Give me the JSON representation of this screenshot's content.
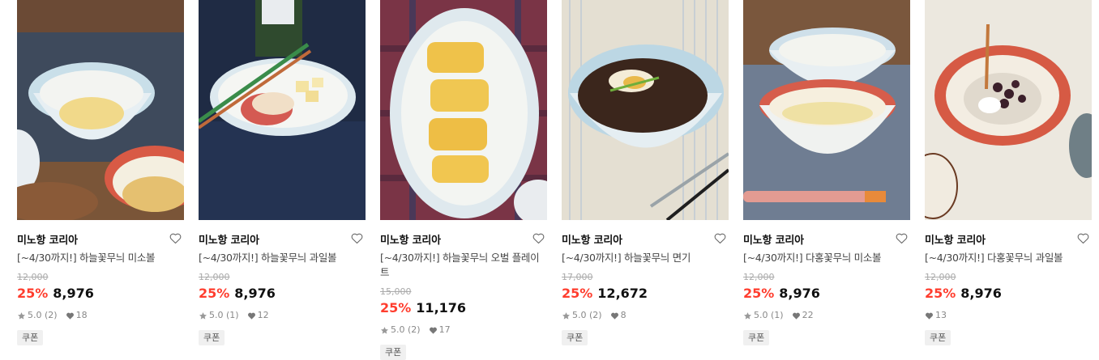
{
  "colors": {
    "accent_discount": "#ff3d2e",
    "text_strong": "#111111",
    "text_muted": "#888888"
  },
  "products": [
    {
      "brand": "미노항 코리아",
      "title": "[~4/30까지!] 하늘꽃무늬 미소볼",
      "original_price": "12,000",
      "discount": "25%",
      "price": "8,976",
      "rating": "5.0 (2)",
      "likes": "18",
      "coupon": "쿠폰",
      "image": "bowl-of-egg-salad"
    },
    {
      "brand": "미노항 코리아",
      "title": "[~4/30까지!] 하늘꽃무늬 과일볼",
      "original_price": "12,000",
      "discount": "25%",
      "price": "8,976",
      "rating": "5.0 (1)",
      "likes": "12",
      "coupon": "쿠폰",
      "image": "fruit-bowl-apples-cheese"
    },
    {
      "brand": "미노항 코리아",
      "title": "[~4/30까지!] 하늘꽃무늬 오벌 플레이트",
      "original_price": "15,000",
      "discount": "25%",
      "price": "11,176",
      "rating": "5.0 (2)",
      "likes": "17",
      "coupon": "쿠폰",
      "image": "oval-plate-rolled-omelette"
    },
    {
      "brand": "미노항 코리아",
      "title": "[~4/30까지!] 하늘꽃무늬 면기",
      "original_price": "17,000",
      "discount": "25%",
      "price": "12,672",
      "rating": "5.0 (2)",
      "likes": "8",
      "coupon": "쿠폰",
      "image": "noodle-bowl-jjajang"
    },
    {
      "brand": "미노항 코리아",
      "title": "[~4/30까지!] 다홍꽃무늬 미소볼",
      "original_price": "12,000",
      "discount": "25%",
      "price": "8,976",
      "rating": "5.0 (1)",
      "likes": "22",
      "coupon": "쿠폰",
      "image": "red-pattern-soup-bowl"
    },
    {
      "brand": "미노항 코리아",
      "title": "[~4/30까지!] 다홍꽃무늬 과일볼",
      "original_price": "12,000",
      "discount": "25%",
      "price": "8,976",
      "rating": "",
      "likes": "13",
      "coupon": "쿠폰",
      "image": "red-pattern-dessert-bowl"
    }
  ]
}
